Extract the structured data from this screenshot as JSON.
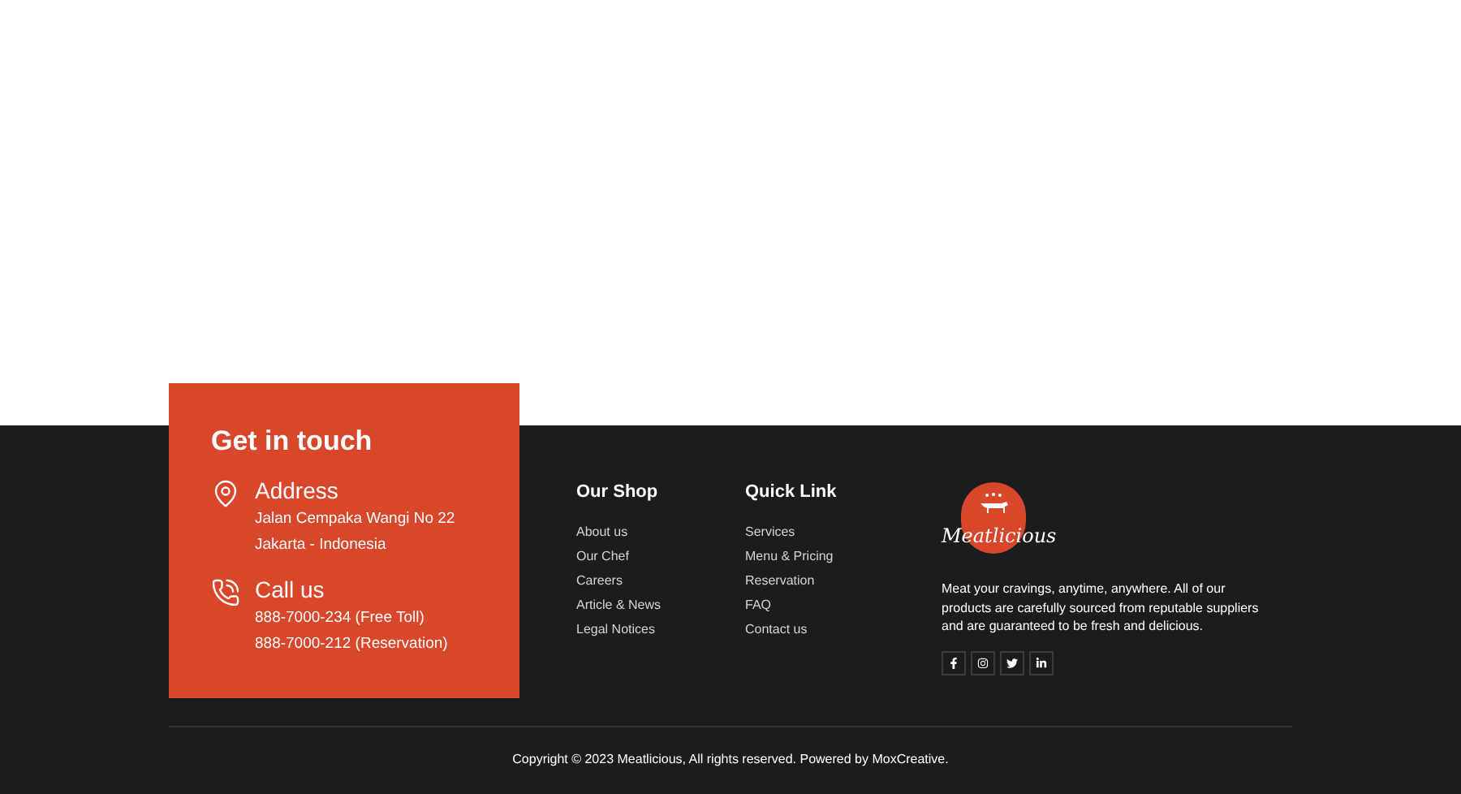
{
  "contact": {
    "title": "Get in touch",
    "sections": [
      {
        "kind": "address",
        "heading": "Address",
        "lines": [
          "Jalan Cempaka Wangi No 22",
          "Jakarta - Indonesia"
        ]
      },
      {
        "kind": "phone",
        "heading": "Call us",
        "lines": [
          "888-7000-234 (Free Toll)",
          "888-7000-212 (Reservation)"
        ]
      }
    ]
  },
  "columns": [
    {
      "heading": "Our Shop",
      "links": [
        "About us",
        "Our Chef",
        "Careers",
        "Article & News",
        "Legal Notices"
      ]
    },
    {
      "heading": "Quick Link",
      "links": [
        "Services",
        "Menu & Pricing",
        "Reservation",
        "FAQ",
        "Contact us"
      ]
    }
  ],
  "brand": {
    "logo_text": "Meatlicious",
    "description": "Meat your cravings, anytime, anywhere. All of our products are carefully sourced from reputable suppliers and are guaranteed to be fresh and delicious.",
    "socials": [
      {
        "kind": "facebook"
      },
      {
        "kind": "instagram"
      },
      {
        "kind": "twitter"
      },
      {
        "kind": "linkedin"
      }
    ]
  },
  "copyright": "Copyright © 2023 Meatlicious, All rights reserved. Powered by MoxCreative."
}
